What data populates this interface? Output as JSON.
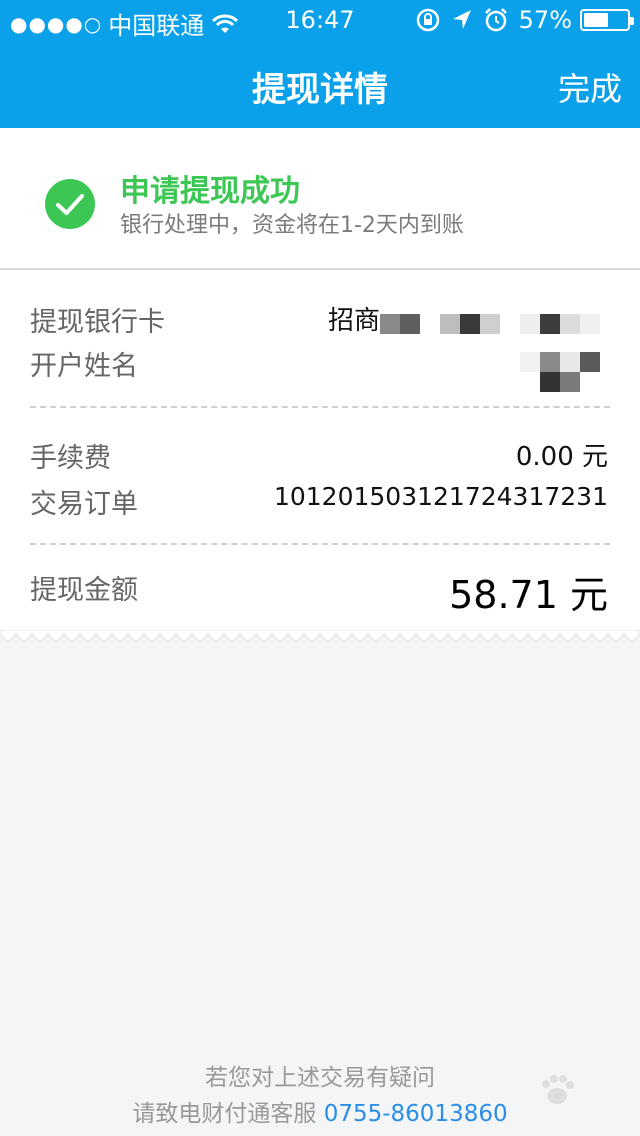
{
  "status_bar": {
    "signal_dots": "●●●●○",
    "carrier": "中国联通",
    "time": "16:47",
    "battery_percent": "57%",
    "battery_level": 0.57
  },
  "nav": {
    "title": "提现详情",
    "done_label": "完成"
  },
  "success": {
    "title": "申请提现成功",
    "subtitle": "银行处理中，资金将在1-2天内到账"
  },
  "details": {
    "bank_card_label": "提现银行卡",
    "bank_card_value": "招商",
    "account_name_label": "开户姓名",
    "fee_label": "手续费",
    "fee_value": "0.00 元",
    "order_label": "交易订单",
    "order_value": "101201503121724317231",
    "amount_label": "提现金额",
    "amount_value": "58.71 元"
  },
  "footer": {
    "line1": "若您对上述交易有疑问",
    "line2_prefix": "请致电财付通客服",
    "phone": "0755-86013860"
  },
  "colors": {
    "header_blue": "#0aa1ea",
    "success_green": "#3cc754",
    "phone_blue": "#2a8ee6"
  }
}
